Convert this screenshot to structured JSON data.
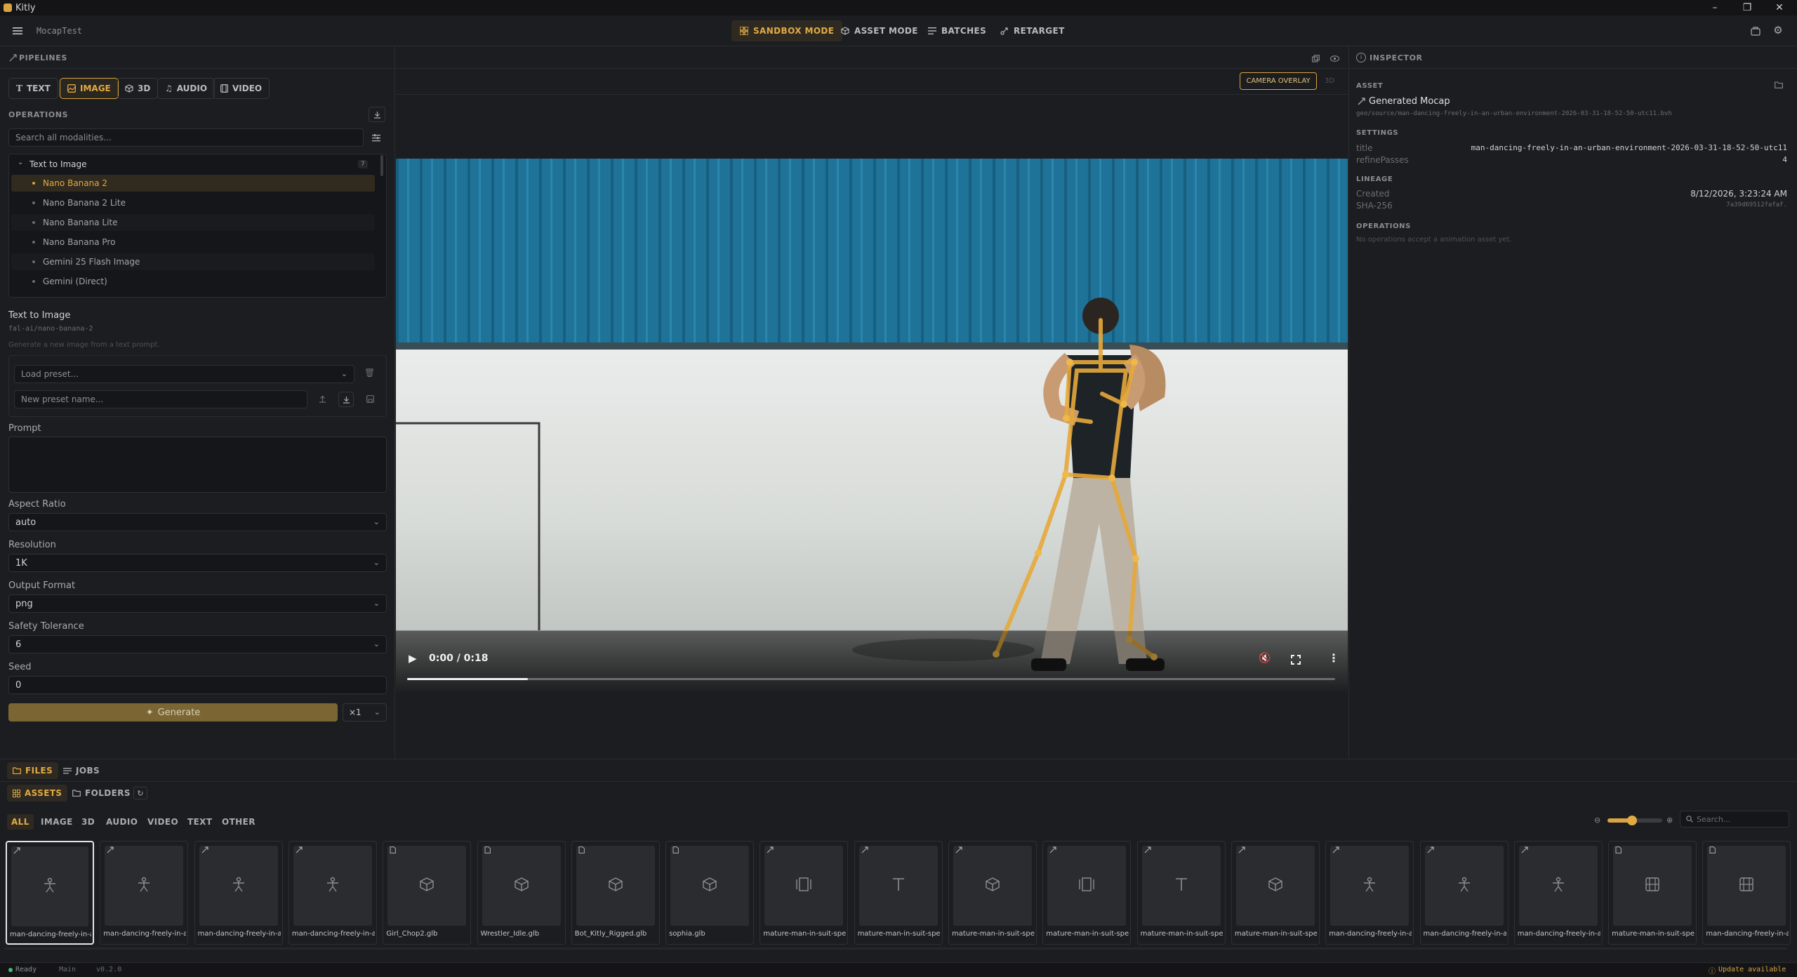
{
  "window": {
    "title": "Kitly",
    "minimize": "–",
    "maximize": "❐",
    "close": "✕"
  },
  "header": {
    "project": "MocapTest",
    "tabs": [
      {
        "label": "SANDBOX MODE",
        "icon": "grid-icon",
        "active": true
      },
      {
        "label": "ASSET MODE",
        "icon": "cube-icon",
        "active": false
      },
      {
        "label": "BATCHES",
        "icon": "list-icon",
        "active": false
      },
      {
        "label": "RETARGET",
        "icon": "retarget-icon",
        "active": false
      }
    ]
  },
  "pipelines": {
    "title": "PIPELINES",
    "modalities": [
      {
        "label": "TEXT",
        "active": false
      },
      {
        "label": "IMAGE",
        "active": true
      },
      {
        "label": "3D",
        "active": false
      },
      {
        "label": "AUDIO",
        "active": false
      },
      {
        "label": "VIDEO",
        "active": false
      }
    ],
    "operations_title": "OPERATIONS",
    "search_placeholder": "Search all modalities...",
    "group": {
      "label": "Text to Image",
      "count": "7"
    },
    "items": [
      {
        "label": "Nano Banana 2",
        "active": true
      },
      {
        "label": "Nano Banana 2 Lite",
        "active": false
      },
      {
        "label": "Nano Banana Lite",
        "active": false
      },
      {
        "label": "Nano Banana Pro",
        "active": false
      },
      {
        "label": "Gemini 25 Flash Image",
        "active": false
      },
      {
        "label": "Gemini (Direct)",
        "active": false
      }
    ],
    "op_title": "Text to Image",
    "op_id": "fal-ai/nano-banana-2",
    "op_desc": "Generate a new image from a text prompt.",
    "preset_placeholder": "Load preset...",
    "preset_name_placeholder": "New preset name...",
    "prompt_label": "Prompt",
    "fields": [
      {
        "label": "Aspect Ratio",
        "value": "auto"
      },
      {
        "label": "Resolution",
        "value": "1K"
      },
      {
        "label": "Output Format",
        "value": "png"
      },
      {
        "label": "Safety Tolerance",
        "value": "6"
      }
    ],
    "seed_label": "Seed",
    "seed_value": "0",
    "generate_label": "Generate",
    "count_label": "×1"
  },
  "viewer": {
    "camera_overlay": "CAMERA OVERLAY",
    "mode_3d": "3D",
    "time": "0:00 / 0:18",
    "progress": 0.13
  },
  "inspector": {
    "title": "INSPECTOR",
    "asset_label": "ASSET",
    "asset_name": "Generated Mocap",
    "asset_path": "geo/source/man-dancing-freely-in-an-urban-environment-2026-03-31-18-52-50-utc11.bvh",
    "settings_label": "SETTINGS",
    "settings": [
      {
        "key": "title",
        "value": "man-dancing-freely-in-an-urban-environment-2026-03-31-18-52-50-utc11"
      },
      {
        "key": "refinePasses",
        "value": "4"
      }
    ],
    "lineage_label": "LINEAGE",
    "created_key": "Created",
    "created_value": "8/12/2026, 3:23:24 AM",
    "sha_key": "SHA-256",
    "sha_value": "7a39d69512fafaf.",
    "operations_label": "OPERATIONS",
    "operations_empty": "No operations accept a animation asset yet."
  },
  "bottom": {
    "tabs": [
      {
        "label": "FILES",
        "active": true
      },
      {
        "label": "JOBS",
        "active": false
      }
    ],
    "subtabs": [
      {
        "label": "ASSETS",
        "active": true
      },
      {
        "label": "FOLDERS",
        "active": false
      }
    ],
    "filters": [
      {
        "label": "ALL",
        "active": true
      },
      {
        "label": "IMAGE",
        "active": false
      },
      {
        "label": "3D",
        "active": false
      },
      {
        "label": "AUDIO",
        "active": false
      },
      {
        "label": "VIDEO",
        "active": false
      },
      {
        "label": "TEXT",
        "active": false
      },
      {
        "label": "OTHER",
        "active": false
      }
    ],
    "zoom": 0.45,
    "search_placeholder": "Search...",
    "assets": [
      {
        "name": "man-dancing-freely-in-an-urban",
        "kind": "mocap",
        "icon": "person-icon",
        "selected": true
      },
      {
        "name": "man-dancing-freely-in-an-urban",
        "kind": "mocap",
        "icon": "person-icon",
        "selected": false
      },
      {
        "name": "man-dancing-freely-in-an-urban",
        "kind": "mocap",
        "icon": "person-icon",
        "selected": false
      },
      {
        "name": "man-dancing-freely-in-an-urban",
        "kind": "mocap",
        "icon": "person-icon",
        "selected": false
      },
      {
        "name": "Girl_Chop2.glb",
        "kind": "file",
        "icon": "cube-icon",
        "selected": false
      },
      {
        "name": "Wrestler_Idle.glb",
        "kind": "file",
        "icon": "cube-icon",
        "selected": false
      },
      {
        "name": "Bot_Kitly_Rigged.glb",
        "kind": "file",
        "icon": "cube-icon",
        "selected": false
      },
      {
        "name": "sophia.glb",
        "kind": "file",
        "icon": "cube-icon",
        "selected": false
      },
      {
        "name": "mature-man-in-suit-speaking",
        "kind": "mocap",
        "icon": "frame-icon",
        "selected": false
      },
      {
        "name": "mature-man-in-suit-speaking",
        "kind": "mocap",
        "icon": "text-icon",
        "selected": false
      },
      {
        "name": "mature-man-in-suit-speaking",
        "kind": "mocap",
        "icon": "cube-icon",
        "selected": false
      },
      {
        "name": "mature-man-in-suit-speaking",
        "kind": "mocap",
        "icon": "frame-icon",
        "selected": false
      },
      {
        "name": "mature-man-in-suit-speaking",
        "kind": "mocap",
        "icon": "text-icon",
        "selected": false
      },
      {
        "name": "mature-man-in-suit-speaking",
        "kind": "mocap",
        "icon": "cube-icon",
        "selected": false
      },
      {
        "name": "man-dancing-freely-in-an-urban",
        "kind": "mocap",
        "icon": "person-icon",
        "selected": false
      },
      {
        "name": "man-dancing-freely-in-an-urban",
        "kind": "mocap",
        "icon": "person-icon",
        "selected": false
      },
      {
        "name": "man-dancing-freely-in-an-urban",
        "kind": "mocap",
        "icon": "person-icon",
        "selected": false
      },
      {
        "name": "mature-man-in-suit-speaking",
        "kind": "file",
        "icon": "film-icon",
        "selected": false
      },
      {
        "name": "man-dancing-freely-in-an-urban",
        "kind": "file",
        "icon": "film-icon",
        "selected": false
      }
    ]
  },
  "status": {
    "ready": "Ready",
    "branch": "Main",
    "version": "v0.2.0",
    "update": "Update available"
  },
  "colors": {
    "accent": "#d9a441",
    "bg": "#1c1d20",
    "panel": "#151619"
  }
}
